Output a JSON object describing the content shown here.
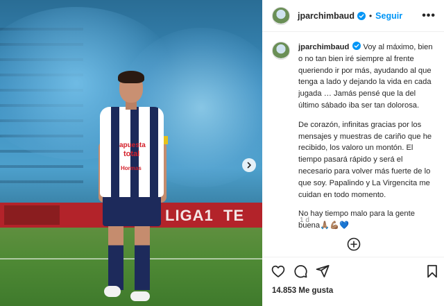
{
  "post": {
    "username": "jparchimbaud",
    "follow_label": "Seguir",
    "separator": "•",
    "more": "•••",
    "caption_paragraphs": [
      "Voy al máximo, bien o no tan bien iré siempre al frente queriendo ir por más, ayudando al que tenga a lado y dejando la vida en cada jugada … Jamás pensé que la del último sábado iba ser tan dolorosa.",
      "De corazón, infinitas gracias por los mensajes y muestras de cariño que he recibido, los valoro un montón. El tiempo pasará rápido y será el necesario para volver más fuerte de lo que soy. Papalindo y La Virgencita me cuidan en todo momento.",
      "No hay tiempo malo para la gente buena🙏🏽💪🏽💙"
    ],
    "time_ago": "1 d",
    "likes": "14.853 Me gusta"
  },
  "photo": {
    "ad_board_1": "LIGA1",
    "ad_board_2": "TE AP",
    "sponsor_1": "apuesta",
    "sponsor_2": "total",
    "sponsor_3": "Hormas"
  },
  "colors": {
    "accent": "#0095f6",
    "text": "#262626",
    "muted": "#8e8e8e"
  },
  "icons": {
    "like": "heart-icon",
    "comment": "comment-icon",
    "share": "send-icon",
    "save": "bookmark-icon",
    "add_comment": "plus-circle-icon",
    "next": "chevron-right-icon",
    "verified": "verified-badge-icon"
  }
}
